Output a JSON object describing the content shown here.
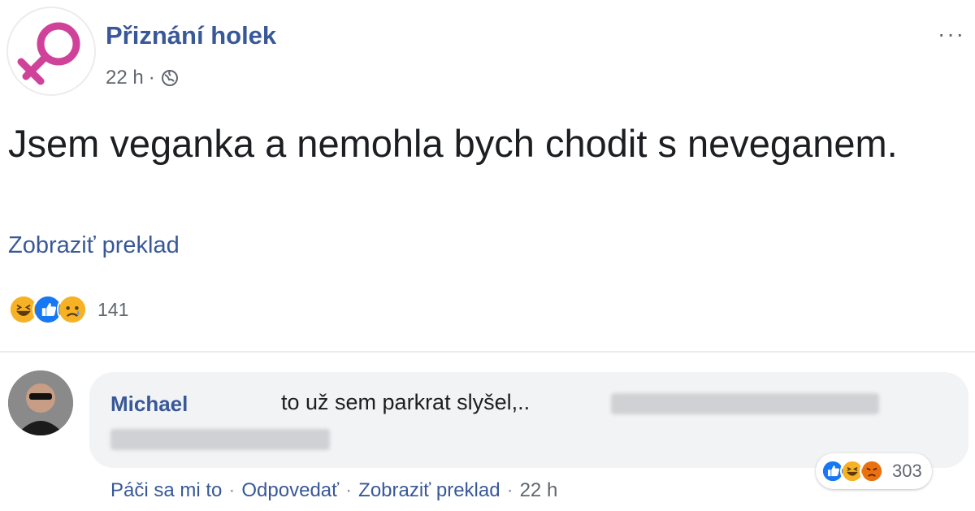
{
  "post": {
    "page_name": "Přiznání holek",
    "time": "22 h",
    "separator": "·",
    "privacy_icon": "globe-icon",
    "more_label": "···",
    "text": "Jsem veganka a nemohla bych chodit s neveganem.",
    "translate_label": "Zobraziť preklad",
    "reactions": {
      "icons": [
        "haha-icon",
        "like-icon",
        "sad-icon"
      ],
      "count": "141"
    }
  },
  "comment": {
    "author": "Michael",
    "text": "to už sem parkrat slyšel,..",
    "reactions": {
      "icons": [
        "like-icon",
        "haha-icon",
        "angry-icon"
      ],
      "count": "303"
    },
    "actions": {
      "like_label": "Páči sa mi to",
      "reply_label": "Odpovedať",
      "translate_label": "Zobraziť preklad",
      "time": "22 h",
      "separator": "·"
    }
  },
  "colors": {
    "link": "#385898",
    "brand_symbol": "#d0429a",
    "like": "#1877f2",
    "haha": "#f7b125",
    "angry": "#e9710f"
  }
}
